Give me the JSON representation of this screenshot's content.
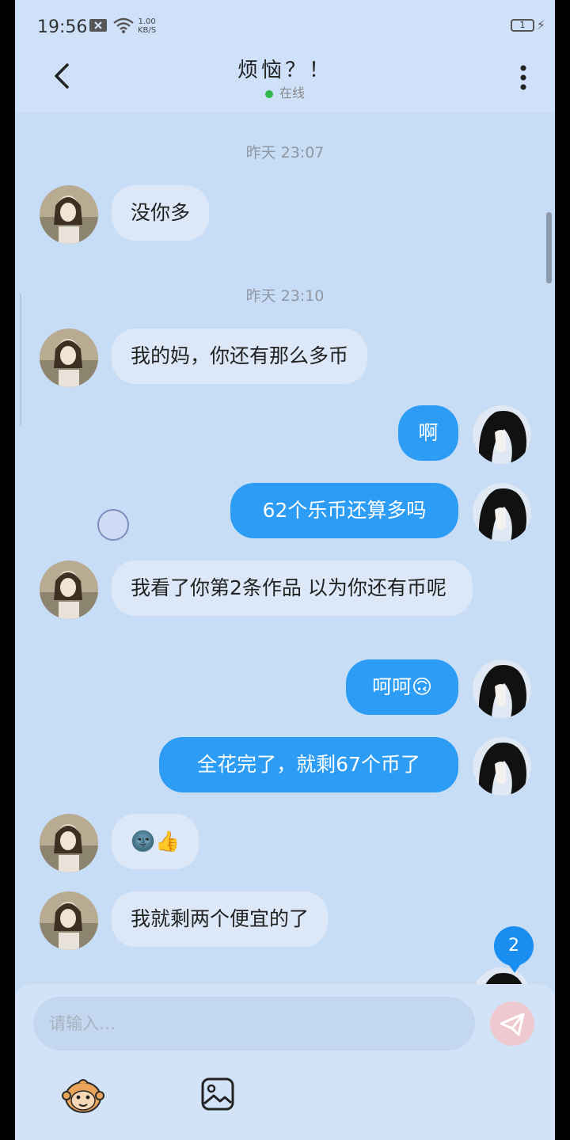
{
  "status_bar": {
    "time": "19:56",
    "net_speed_value": "1.00",
    "net_speed_unit": "KB/S",
    "battery": "1"
  },
  "header": {
    "title": "烦恼？！",
    "status": "在线"
  },
  "messages": [
    {
      "type": "timestamp",
      "text": "昨天 23:07"
    },
    {
      "type": "in",
      "text": "没你多"
    },
    {
      "type": "timestamp",
      "text": "昨天 23:10"
    },
    {
      "type": "in",
      "text": "我的妈，你还有那么多币"
    },
    {
      "type": "out",
      "text": "啊"
    },
    {
      "type": "out",
      "text": "62个乐币还算多吗"
    },
    {
      "type": "in",
      "text": "我看了你第2条作品 以为你还有币呢"
    },
    {
      "type": "out",
      "text": "呵呵🙃"
    },
    {
      "type": "out",
      "text": "全花完了，就剩67个币了"
    },
    {
      "type": "in",
      "text": "🌚👍"
    },
    {
      "type": "in",
      "text": "我就剩两个便宜的了"
    }
  ],
  "unread_badge": "2",
  "composer": {
    "placeholder": "请输入…"
  },
  "colors": {
    "accent": "#2c9cf5",
    "background": "#c7dcf5",
    "online": "#31b84a"
  },
  "icons": [
    "back-icon",
    "more-icon",
    "send-icon",
    "monkey-emoji-icon",
    "image-icon"
  ]
}
